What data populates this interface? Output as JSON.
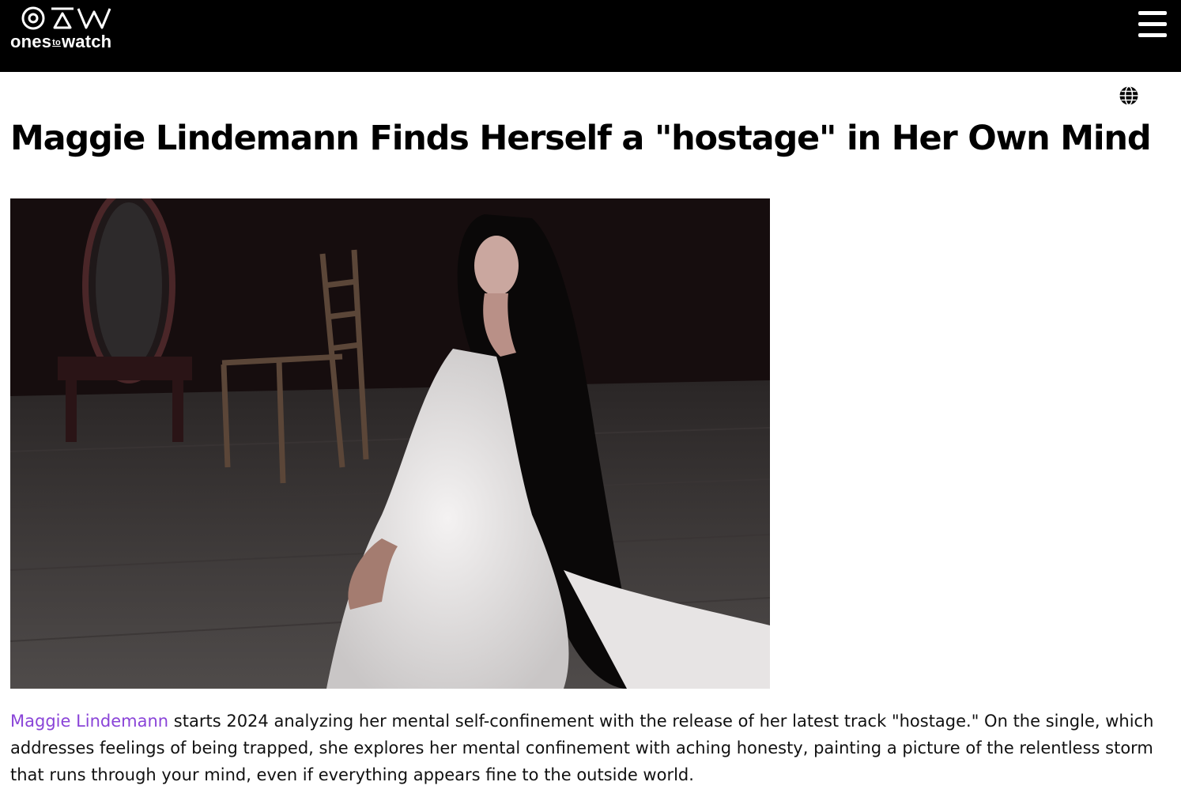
{
  "header": {
    "logo_text_left": "ones",
    "logo_text_to": "to",
    "logo_text_right": "watch",
    "menu_icon": "hamburger-icon"
  },
  "toolbar": {
    "language_icon": "globe-icon"
  },
  "article": {
    "title": "Maggie Lindemann Finds Herself a \"hostage\" in Her Own Mind",
    "artist_link": "Maggie Lindemann",
    "body": " starts 2024 analyzing her mental self-confinement with the release of her latest track \"hostage.\" On the single, which addresses feelings of being trapped, she explores her mental confinement with aching honesty, painting a picture of the relentless storm that runs through your mind, even if everything appears fine to the outside world."
  },
  "colors": {
    "header_bg": "#000000",
    "link": "#8a44d8"
  }
}
